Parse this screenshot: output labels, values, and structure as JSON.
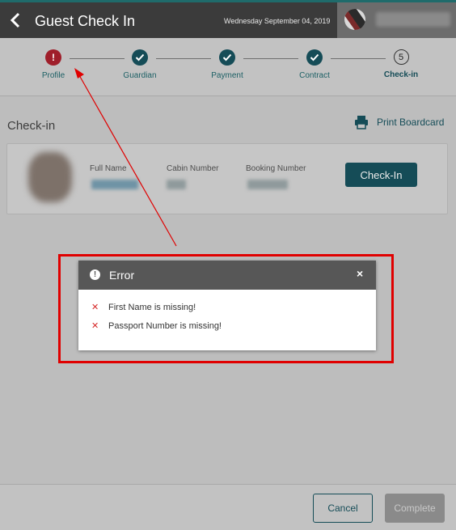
{
  "header": {
    "title": "Guest Check In",
    "date": "Wednesday September 04, 2019",
    "back_icon": "chevron-left-icon"
  },
  "stepper": {
    "steps": [
      {
        "label": "Profile",
        "state": "error",
        "glyph": "!"
      },
      {
        "label": "Guardian",
        "state": "done"
      },
      {
        "label": "Payment",
        "state": "done"
      },
      {
        "label": "Contract",
        "state": "done"
      },
      {
        "label": "Check-in",
        "state": "current",
        "glyph": "5"
      }
    ]
  },
  "main": {
    "section_title": "Check-in",
    "print_label": "Print Boardcard",
    "card": {
      "full_name_label": "Full Name",
      "cabin_label": "Cabin Number",
      "booking_label": "Booking Number",
      "checkin_button": "Check-In"
    }
  },
  "dialog": {
    "title": "Error",
    "close_glyph": "×",
    "icon_glyph": "!",
    "errors": [
      "First Name is missing!",
      "Passport Number is missing!"
    ],
    "error_glyph": "✕"
  },
  "footer": {
    "cancel_label": "Cancel",
    "complete_label": "Complete"
  },
  "colors": {
    "accent": "#154c57",
    "error": "#9f1e2a",
    "annotation": "#e00000"
  }
}
